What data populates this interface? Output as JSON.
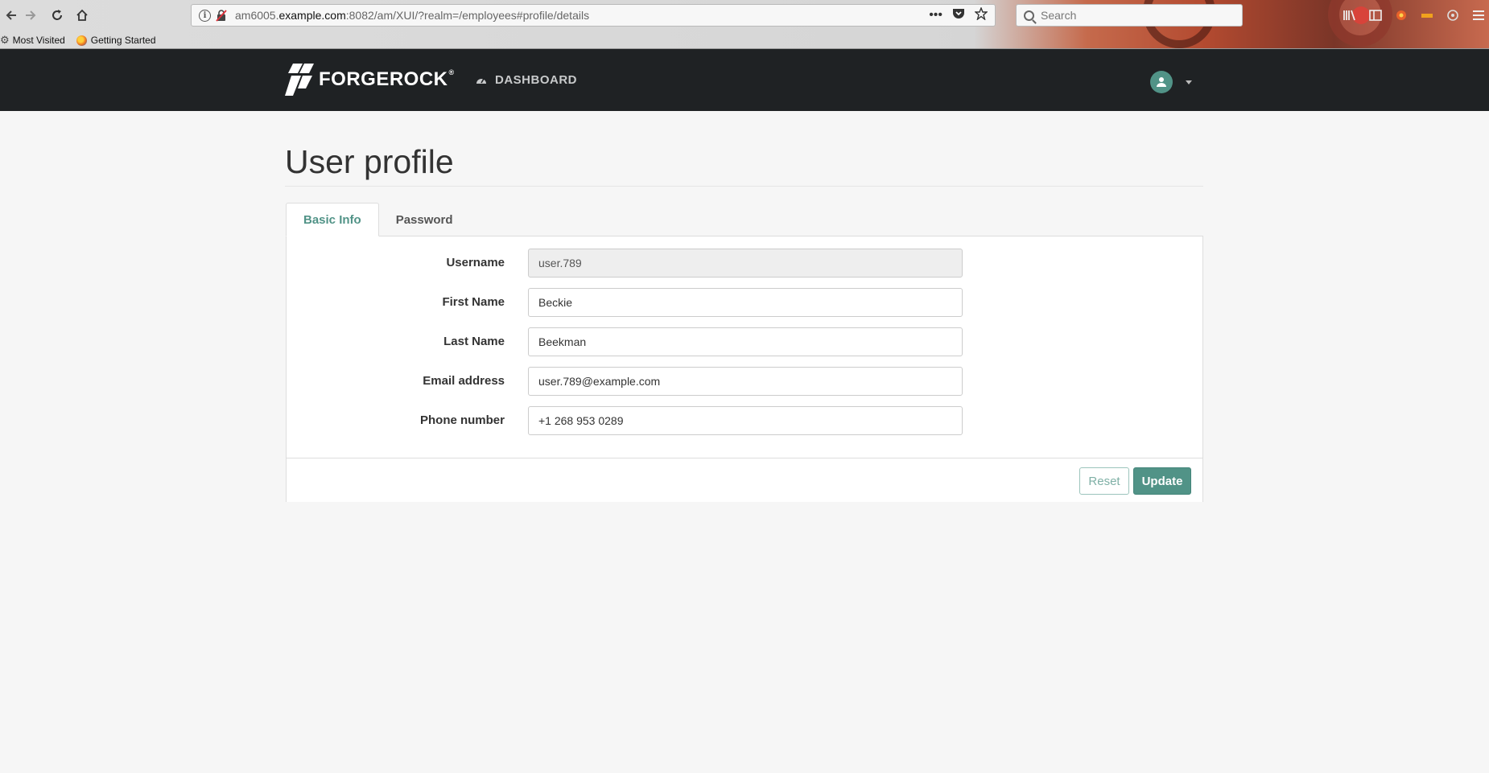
{
  "browser": {
    "url_prefix": "am6005.",
    "url_host": "example.com",
    "url_rest": ":8082/am/XUI/?realm=/employees#profile/details",
    "more_label": "•••",
    "search_placeholder": "Search",
    "bookmarks": [
      {
        "label": "Most Visited"
      },
      {
        "label": "Getting Started"
      }
    ]
  },
  "nav": {
    "brand": "FORGEROCK",
    "dashboard_label": "DASHBOARD"
  },
  "page": {
    "title": "User profile",
    "tabs": [
      {
        "label": "Basic Info",
        "active": true
      },
      {
        "label": "Password",
        "active": false
      }
    ],
    "fields": [
      {
        "label": "Username",
        "value": "user.789",
        "readonly": true
      },
      {
        "label": "First Name",
        "value": "Beckie"
      },
      {
        "label": "Last Name",
        "value": "Beekman"
      },
      {
        "label": "Email address",
        "value": "user.789@example.com"
      },
      {
        "label": "Phone number",
        "value": "+1 268 953 0289"
      }
    ],
    "buttons": {
      "reset": "Reset",
      "update": "Update"
    }
  },
  "colors": {
    "accent": "#519387",
    "navbar": "#1f2224",
    "page_bg": "#f6f6f6"
  }
}
